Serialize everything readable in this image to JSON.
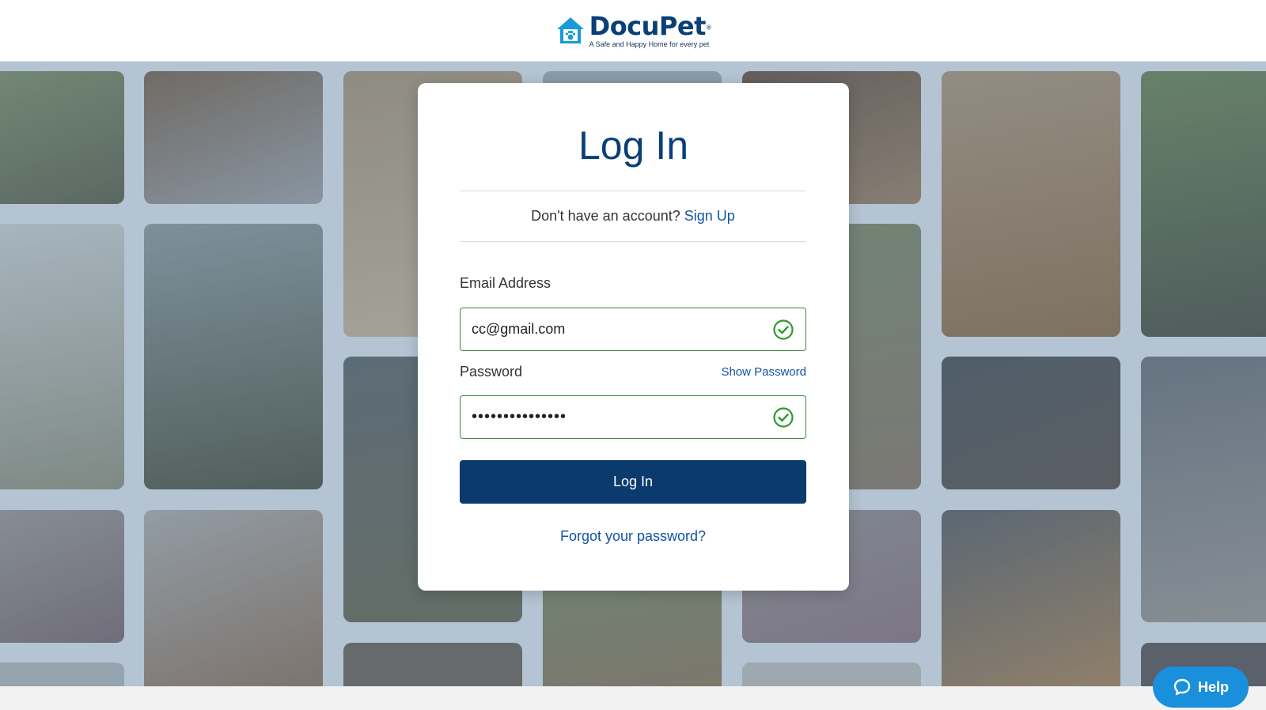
{
  "header": {
    "brand_name": "DocuPet",
    "trademark": "®",
    "tagline": "A Safe and Happy Home for every pet",
    "logo_icon": "house-paw-icon",
    "brand_color": "#0a3f77",
    "icon_color": "#1a9ad6"
  },
  "background": {
    "description_icon": "pet-photo-tile",
    "tile_colors": [
      "#5d6e52",
      "#6b5a48",
      "#8a7a66",
      "#4f5c6b",
      "#7c6a55",
      "#3d4a3f",
      "#9a8870",
      "#586470",
      "#6e7b62",
      "#83705b",
      "#4a5560",
      "#725f4e"
    ]
  },
  "login": {
    "title": "Log In",
    "no_account_text": "Don't have an account?",
    "signup_label": "Sign Up",
    "email_label": "Email Address",
    "email_value": "cc@gmail.com",
    "password_label": "Password",
    "show_password_label": "Show Password",
    "password_masked": "•••••••••••••••",
    "login_button": "Log In",
    "forgot_password": "Forgot your password?",
    "valid_icon": "check-circle-icon",
    "valid_color": "#2e9a2e",
    "primary_color": "#0a3a6e",
    "link_color": "#1253a8"
  },
  "help": {
    "label": "Help",
    "icon": "chat-bubble-icon",
    "color": "#1a8fdc"
  }
}
